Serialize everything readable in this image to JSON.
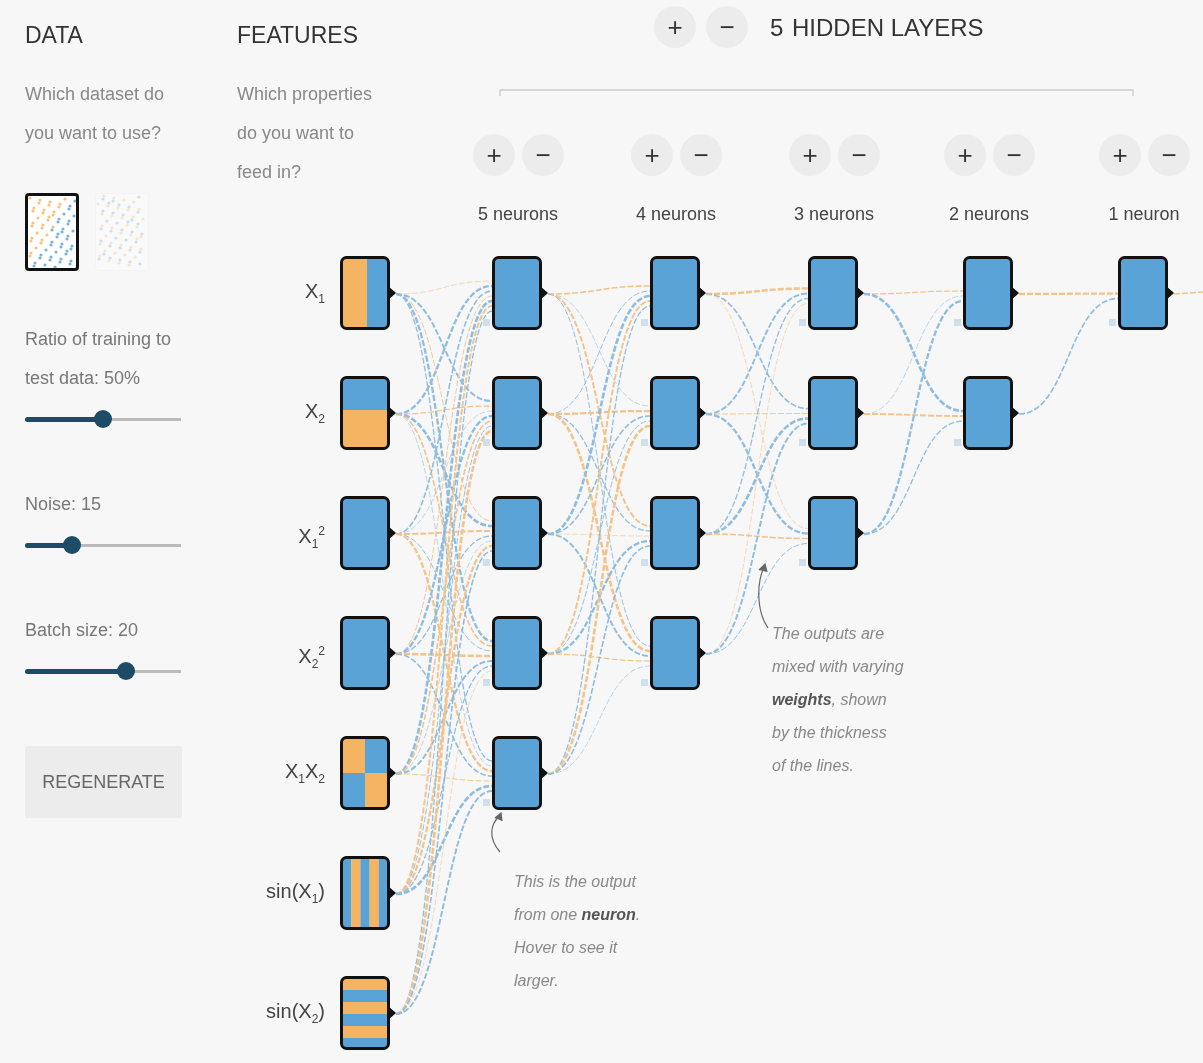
{
  "data_panel": {
    "title": "DATA",
    "question": "Which dataset do you want to use?",
    "datasets": [
      {
        "selected": true
      },
      {
        "selected": false
      }
    ],
    "sliders": [
      {
        "label": "Ratio of training to test data: 50%",
        "level": 0.5
      },
      {
        "label": "Noise: 15",
        "level": 0.3
      },
      {
        "label": "Batch size: 20",
        "level": 0.65
      }
    ],
    "regenerate_button": "REGENERATE"
  },
  "features_panel": {
    "title": "FEATURES",
    "question": "Which properties do you want to feed in?",
    "features": [
      {
        "label": "X$_{1}$",
        "kind": "vertical-split"
      },
      {
        "label": "X$_{2}$",
        "kind": "horizontal-split"
      },
      {
        "label": "X$_{1}$$^{2}$",
        "kind": "solid"
      },
      {
        "label": "X$_{2}$$^{2}$",
        "kind": "solid"
      },
      {
        "label": "X$_{1}$X$_{2}$",
        "kind": "checker"
      },
      {
        "label": "sin(X$_{1}$)",
        "kind": "vertical-stripes"
      },
      {
        "label": "sin(X$_{2}$)",
        "kind": "horizontal-stripes"
      }
    ]
  },
  "network": {
    "add_layer_button": "+",
    "remove_layer_button": "−",
    "layers_count": "5",
    "layers_label": "HIDDEN LAYERS",
    "layers": [
      {
        "add_button": "+",
        "remove_button": "−",
        "label": "5 neurons",
        "neurons": [
          {
            "kind": "solid"
          },
          {
            "kind": "solid"
          },
          {
            "kind": "solid"
          },
          {
            "kind": "solid"
          },
          {
            "kind": "solid"
          }
        ]
      },
      {
        "add_button": "+",
        "remove_button": "−",
        "label": "4 neurons",
        "neurons": [
          {
            "kind": "solid"
          },
          {
            "kind": "solid"
          },
          {
            "kind": "solid"
          },
          {
            "kind": "solid"
          }
        ]
      },
      {
        "add_button": "+",
        "remove_button": "−",
        "label": "3 neurons",
        "neurons": [
          {
            "kind": "solid"
          },
          {
            "kind": "solid"
          },
          {
            "kind": "solid"
          }
        ]
      },
      {
        "add_button": "+",
        "remove_button": "−",
        "label": "2 neurons",
        "neurons": [
          {
            "kind": "solid"
          },
          {
            "kind": "solid"
          }
        ]
      },
      {
        "add_button": "+",
        "remove_button": "−",
        "label": "1 neuron",
        "neurons": [
          {
            "kind": "solid"
          }
        ]
      }
    ]
  },
  "annotations": [
    {
      "text": "This is the output from one **neuron**. Hover to see it larger."
    },
    {
      "text": "The outputs are mixed with varying **weights**, shown by the thickness of the lines."
    }
  ]
}
